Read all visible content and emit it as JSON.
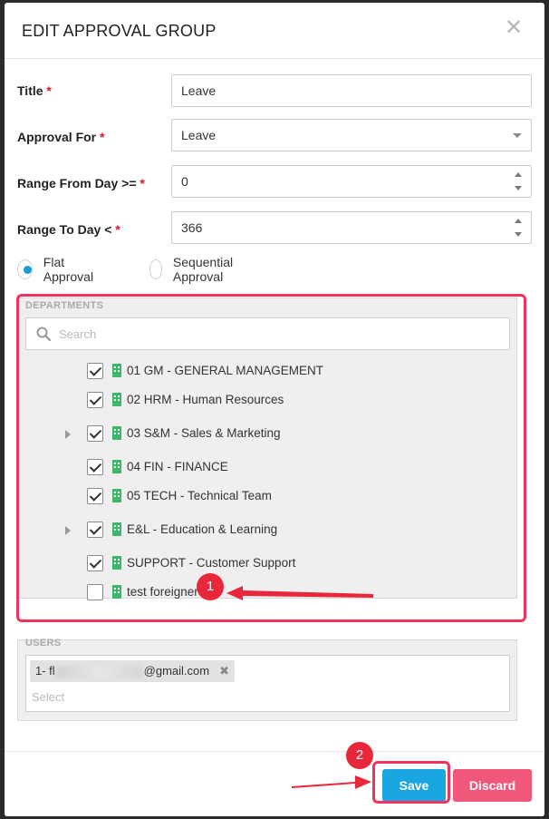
{
  "modal": {
    "title": "EDIT APPROVAL GROUP",
    "close_glyph": "✕"
  },
  "form": {
    "title_label": "Title",
    "title_value": "Leave",
    "approval_for_label": "Approval For",
    "approval_for_value": "Leave",
    "range_from_label": "Range From Day >=",
    "range_from_value": "0",
    "range_to_label": "Range To Day <",
    "range_to_value": "366",
    "required_mark": "*",
    "radios": [
      {
        "label": "Flat Approval",
        "checked": true
      },
      {
        "label": "Sequential Approval",
        "checked": false
      }
    ]
  },
  "departments": {
    "legend": "DEPARTMENTS",
    "search_placeholder": "Search",
    "items": [
      {
        "label": "01 GM - GENERAL MANAGEMENT",
        "checked": true,
        "expandable": false
      },
      {
        "label": "02 HRM - Human Resources",
        "checked": true,
        "expandable": false
      },
      {
        "label": "03 S&M - Sales & Marketing",
        "checked": true,
        "expandable": true
      },
      {
        "label": "04 FIN - FINANCE",
        "checked": true,
        "expandable": false
      },
      {
        "label": "05 TECH - Technical Team",
        "checked": true,
        "expandable": false
      },
      {
        "label": "E&L - Education & Learning",
        "checked": true,
        "expandable": true
      },
      {
        "label": "SUPPORT - Customer Support",
        "checked": true,
        "expandable": false
      },
      {
        "label": "test foreigner",
        "checked": false,
        "expandable": false
      }
    ]
  },
  "users": {
    "legend": "USERS",
    "chip_prefix": "1- fl",
    "chip_suffix": "@gmail.com",
    "chip_remove": "✖",
    "select_placeholder": "Select"
  },
  "footer": {
    "save_label": "Save",
    "discard_label": "Discard"
  },
  "annotations": {
    "step1": "1",
    "step2": "2"
  },
  "colors": {
    "accent": "#1aa6e0",
    "danger": "#f1577b",
    "highlight": "#f0325e",
    "dept_icon": "#3cb66b"
  }
}
